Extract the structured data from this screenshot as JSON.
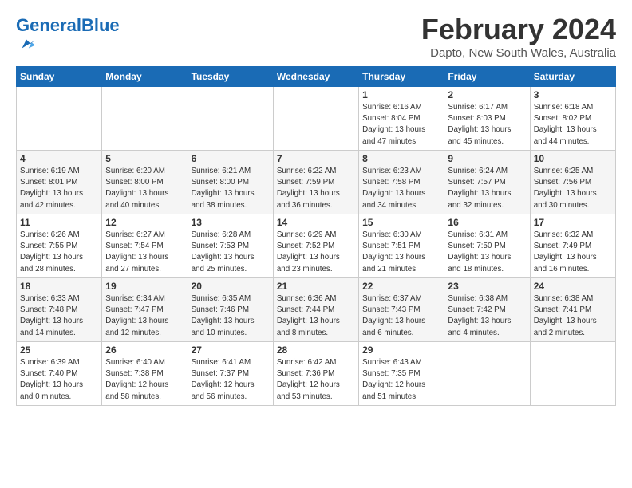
{
  "logo": {
    "text_general": "General",
    "text_blue": "Blue"
  },
  "header": {
    "month": "February 2024",
    "location": "Dapto, New South Wales, Australia"
  },
  "weekdays": [
    "Sunday",
    "Monday",
    "Tuesday",
    "Wednesday",
    "Thursday",
    "Friday",
    "Saturday"
  ],
  "weeks": [
    [
      {
        "day": "",
        "info": ""
      },
      {
        "day": "",
        "info": ""
      },
      {
        "day": "",
        "info": ""
      },
      {
        "day": "",
        "info": ""
      },
      {
        "day": "1",
        "info": "Sunrise: 6:16 AM\nSunset: 8:04 PM\nDaylight: 13 hours\nand 47 minutes."
      },
      {
        "day": "2",
        "info": "Sunrise: 6:17 AM\nSunset: 8:03 PM\nDaylight: 13 hours\nand 45 minutes."
      },
      {
        "day": "3",
        "info": "Sunrise: 6:18 AM\nSunset: 8:02 PM\nDaylight: 13 hours\nand 44 minutes."
      }
    ],
    [
      {
        "day": "4",
        "info": "Sunrise: 6:19 AM\nSunset: 8:01 PM\nDaylight: 13 hours\nand 42 minutes."
      },
      {
        "day": "5",
        "info": "Sunrise: 6:20 AM\nSunset: 8:00 PM\nDaylight: 13 hours\nand 40 minutes."
      },
      {
        "day": "6",
        "info": "Sunrise: 6:21 AM\nSunset: 8:00 PM\nDaylight: 13 hours\nand 38 minutes."
      },
      {
        "day": "7",
        "info": "Sunrise: 6:22 AM\nSunset: 7:59 PM\nDaylight: 13 hours\nand 36 minutes."
      },
      {
        "day": "8",
        "info": "Sunrise: 6:23 AM\nSunset: 7:58 PM\nDaylight: 13 hours\nand 34 minutes."
      },
      {
        "day": "9",
        "info": "Sunrise: 6:24 AM\nSunset: 7:57 PM\nDaylight: 13 hours\nand 32 minutes."
      },
      {
        "day": "10",
        "info": "Sunrise: 6:25 AM\nSunset: 7:56 PM\nDaylight: 13 hours\nand 30 minutes."
      }
    ],
    [
      {
        "day": "11",
        "info": "Sunrise: 6:26 AM\nSunset: 7:55 PM\nDaylight: 13 hours\nand 28 minutes."
      },
      {
        "day": "12",
        "info": "Sunrise: 6:27 AM\nSunset: 7:54 PM\nDaylight: 13 hours\nand 27 minutes."
      },
      {
        "day": "13",
        "info": "Sunrise: 6:28 AM\nSunset: 7:53 PM\nDaylight: 13 hours\nand 25 minutes."
      },
      {
        "day": "14",
        "info": "Sunrise: 6:29 AM\nSunset: 7:52 PM\nDaylight: 13 hours\nand 23 minutes."
      },
      {
        "day": "15",
        "info": "Sunrise: 6:30 AM\nSunset: 7:51 PM\nDaylight: 13 hours\nand 21 minutes."
      },
      {
        "day": "16",
        "info": "Sunrise: 6:31 AM\nSunset: 7:50 PM\nDaylight: 13 hours\nand 18 minutes."
      },
      {
        "day": "17",
        "info": "Sunrise: 6:32 AM\nSunset: 7:49 PM\nDaylight: 13 hours\nand 16 minutes."
      }
    ],
    [
      {
        "day": "18",
        "info": "Sunrise: 6:33 AM\nSunset: 7:48 PM\nDaylight: 13 hours\nand 14 minutes."
      },
      {
        "day": "19",
        "info": "Sunrise: 6:34 AM\nSunset: 7:47 PM\nDaylight: 13 hours\nand 12 minutes."
      },
      {
        "day": "20",
        "info": "Sunrise: 6:35 AM\nSunset: 7:46 PM\nDaylight: 13 hours\nand 10 minutes."
      },
      {
        "day": "21",
        "info": "Sunrise: 6:36 AM\nSunset: 7:44 PM\nDaylight: 13 hours\nand 8 minutes."
      },
      {
        "day": "22",
        "info": "Sunrise: 6:37 AM\nSunset: 7:43 PM\nDaylight: 13 hours\nand 6 minutes."
      },
      {
        "day": "23",
        "info": "Sunrise: 6:38 AM\nSunset: 7:42 PM\nDaylight: 13 hours\nand 4 minutes."
      },
      {
        "day": "24",
        "info": "Sunrise: 6:38 AM\nSunset: 7:41 PM\nDaylight: 13 hours\nand 2 minutes."
      }
    ],
    [
      {
        "day": "25",
        "info": "Sunrise: 6:39 AM\nSunset: 7:40 PM\nDaylight: 13 hours\nand 0 minutes."
      },
      {
        "day": "26",
        "info": "Sunrise: 6:40 AM\nSunset: 7:38 PM\nDaylight: 12 hours\nand 58 minutes."
      },
      {
        "day": "27",
        "info": "Sunrise: 6:41 AM\nSunset: 7:37 PM\nDaylight: 12 hours\nand 56 minutes."
      },
      {
        "day": "28",
        "info": "Sunrise: 6:42 AM\nSunset: 7:36 PM\nDaylight: 12 hours\nand 53 minutes."
      },
      {
        "day": "29",
        "info": "Sunrise: 6:43 AM\nSunset: 7:35 PM\nDaylight: 12 hours\nand 51 minutes."
      },
      {
        "day": "",
        "info": ""
      },
      {
        "day": "",
        "info": ""
      }
    ]
  ]
}
